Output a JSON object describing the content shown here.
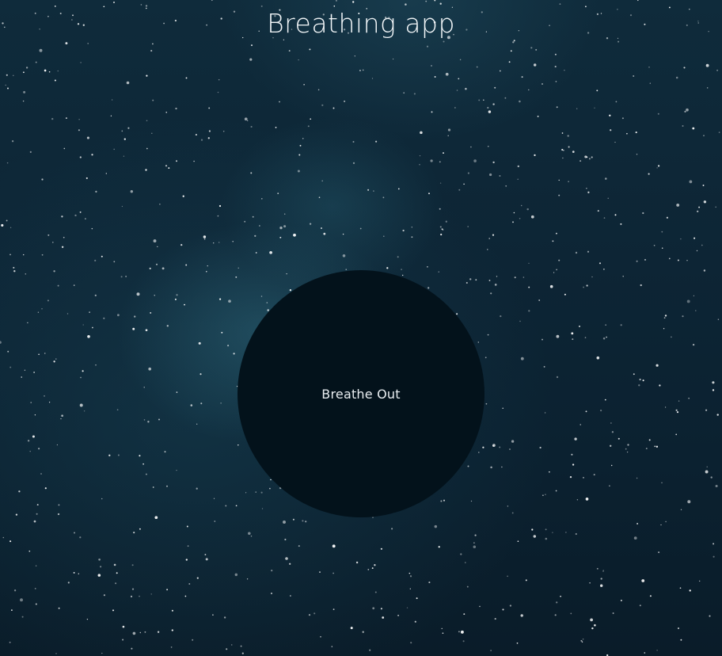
{
  "app": {
    "title": "Breathing app"
  },
  "breath": {
    "instruction": "Breathe Out"
  },
  "colors": {
    "background_top": "#0f2b3b",
    "background_bottom": "#0a1c29",
    "circle_fill": "#03121b",
    "text": "#f2f6f8"
  }
}
